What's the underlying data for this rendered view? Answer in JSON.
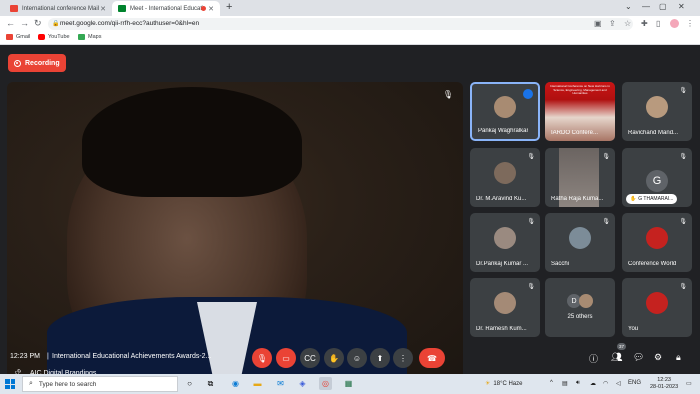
{
  "browser": {
    "tabs": [
      {
        "title": "International conference Mail",
        "active": false
      },
      {
        "title": "Meet - International Educati",
        "active": true,
        "recording": true
      }
    ],
    "url": "meet.google.com/qii-rrfh-ecc?authuser=0&hl=en",
    "bookmarks": [
      "Gmail",
      "YouTube",
      "Maps"
    ]
  },
  "meet": {
    "recording_label": "Recording",
    "main_speaker_name": "AIC Digital Brandings",
    "participants": [
      {
        "name": "Pankaj Waghralkar",
        "speaking": true
      },
      {
        "name": "IARDO Confere...",
        "poster": "International Conference on New Horizons in Science, Engineering, Management and Humanities"
      },
      {
        "name": "Ravichand Mand..."
      },
      {
        "name": "Dr. M.Aravind Ku..."
      },
      {
        "name": "Ratha Raja Kuma..."
      },
      {
        "name": "G THAMARAI...",
        "initial": "G"
      },
      {
        "name": "Dr.Pankaj Kumar ..."
      },
      {
        "name": "Sacchi"
      },
      {
        "name": "Conference World"
      },
      {
        "name": "Dr. Ramesh Kum..."
      },
      {
        "name": "25 others",
        "initial": "D"
      },
      {
        "name": "You"
      }
    ],
    "clock": "12:23 PM",
    "meeting_title": "International Educational Achievements Awards-2...",
    "participant_count": "37"
  },
  "taskbar": {
    "search_placeholder": "Type here to search",
    "weather": "18°C  Haze",
    "lang": "ENG",
    "time": "12:23",
    "date": "28-01-2023"
  },
  "colors": {
    "accent": "#8ab4f8",
    "record": "#ea4335",
    "meet_bg": "#202124"
  }
}
